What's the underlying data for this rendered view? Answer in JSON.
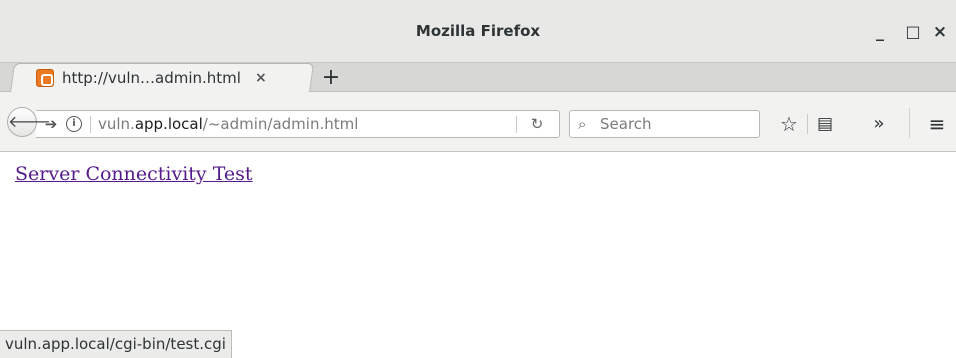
{
  "window": {
    "title": "Mozilla Firefox",
    "minimize_glyph": "_",
    "maximize_glyph": "□",
    "close_glyph": "×"
  },
  "tab": {
    "title": "http://vuln…admin.html",
    "close_glyph": "×",
    "favicon_icon": "xampp-favicon-icon",
    "favicon_color": "#ec7a21"
  },
  "newtab": {
    "glyph": "+"
  },
  "nav": {
    "back_glyph": "🡐",
    "forward_glyph": "➔",
    "info_glyph": "i",
    "url_prefix": "vuln.",
    "url_host": "app.local",
    "url_path": "/~admin/admin.html",
    "reload_glyph": "↻",
    "search_glyph": "⌕",
    "search_placeholder": "Search",
    "bookmark_glyph": "☆",
    "reader_glyph": "▤",
    "overflow_glyph": "»",
    "menu_glyph": "≡"
  },
  "page": {
    "link_text": "Server Connectivity Test",
    "link_color": "#551a8b"
  },
  "status": {
    "text": "vuln.app.local/cgi-bin/test.cgi"
  }
}
